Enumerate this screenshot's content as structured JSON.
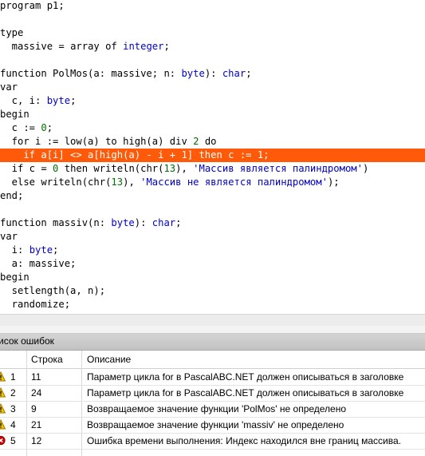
{
  "editor": {
    "lines": [
      [
        {
          "t": "program p1;",
          "c": "kw"
        }
      ],
      [],
      [
        {
          "t": "type",
          "c": "kw"
        }
      ],
      [
        {
          "t": "  massive = ",
          "c": "kw"
        },
        {
          "t": "array of ",
          "c": "kw"
        },
        {
          "t": "integer",
          "c": "typ"
        },
        {
          "t": ";",
          "c": "kw"
        }
      ],
      [],
      [
        {
          "t": "function PolMos(a: massive; n: ",
          "c": "kw"
        },
        {
          "t": "byte",
          "c": "typ"
        },
        {
          "t": "): ",
          "c": "kw"
        },
        {
          "t": "char",
          "c": "typ"
        },
        {
          "t": ";",
          "c": "kw"
        }
      ],
      [
        {
          "t": "var",
          "c": "kw"
        }
      ],
      [
        {
          "t": "  c, i: ",
          "c": "kw"
        },
        {
          "t": "byte",
          "c": "typ"
        },
        {
          "t": ";",
          "c": "kw"
        }
      ],
      [
        {
          "t": "begin",
          "c": "kw"
        }
      ],
      [
        {
          "t": "  c := ",
          "c": "kw"
        },
        {
          "t": "0",
          "c": "num"
        },
        {
          "t": ";",
          "c": "kw"
        }
      ],
      [
        {
          "t": "  for i := low(a) to high(a) div ",
          "c": "kw"
        },
        {
          "t": "2",
          "c": "num"
        },
        {
          "t": " do",
          "c": "kw"
        }
      ],
      [
        {
          "t": "    if a[i] <> a[high(a) - i + 1] then c := 1;",
          "c": "kw"
        }
      ],
      [
        {
          "t": "  if c = ",
          "c": "kw"
        },
        {
          "t": "0",
          "c": "num"
        },
        {
          "t": " then writeln(chr(",
          "c": "kw"
        },
        {
          "t": "13",
          "c": "num"
        },
        {
          "t": "), ",
          "c": "kw"
        },
        {
          "t": "'Массив является палиндромом'",
          "c": "str"
        },
        {
          "t": ")",
          "c": "kw"
        }
      ],
      [
        {
          "t": "  else writeln(chr(",
          "c": "kw"
        },
        {
          "t": "13",
          "c": "num"
        },
        {
          "t": "), ",
          "c": "kw"
        },
        {
          "t": "'Массив не является палиндромом'",
          "c": "str"
        },
        {
          "t": ");",
          "c": "kw"
        }
      ],
      [
        {
          "t": "end;",
          "c": "kw"
        }
      ],
      [],
      [
        {
          "t": "function massiv(n: ",
          "c": "kw"
        },
        {
          "t": "byte",
          "c": "typ"
        },
        {
          "t": "): ",
          "c": "kw"
        },
        {
          "t": "char",
          "c": "typ"
        },
        {
          "t": ";",
          "c": "kw"
        }
      ],
      [
        {
          "t": "var",
          "c": "kw"
        }
      ],
      [
        {
          "t": "  i: ",
          "c": "kw"
        },
        {
          "t": "byte",
          "c": "typ"
        },
        {
          "t": ";",
          "c": "kw"
        }
      ],
      [
        {
          "t": "  a: massive;",
          "c": "kw"
        }
      ],
      [
        {
          "t": "begin",
          "c": "kw"
        }
      ],
      [
        {
          "t": "  setlength(a, n);",
          "c": "kw"
        }
      ],
      [
        {
          "t": "  randomize;",
          "c": "kw"
        }
      ]
    ],
    "highlighted_line_index": 11
  },
  "error_panel": {
    "title": "исок ошибок",
    "columns": {
      "line": "Строка",
      "description": "Описание"
    },
    "rows": [
      {
        "num": "1",
        "line": "11",
        "icon": "warning-icon",
        "description": "Параметр цикла for в PascalABC.NET должен описываться в заголовке"
      },
      {
        "num": "2",
        "line": "24",
        "icon": "warning-icon",
        "description": "Параметр цикла for в PascalABC.NET должен описываться в заголовке"
      },
      {
        "num": "3",
        "line": "9",
        "icon": "warning-icon",
        "description": "Возвращаемое значение функции 'PolMos' не определено"
      },
      {
        "num": "4",
        "line": "21",
        "icon": "warning-icon",
        "description": "Возвращаемое значение функции 'massiv' не определено"
      },
      {
        "num": "5",
        "line": "12",
        "icon": "error-icon",
        "description": "Ошибка времени выполнения: Индекс находился вне границ массива."
      }
    ]
  },
  "colors": {
    "highlight": "#ff5a0a",
    "keyword": "#000000",
    "type": "#0000cc",
    "number": "#007000",
    "string": "#0000c8",
    "warning": "#f5c400",
    "error": "#d40000"
  }
}
